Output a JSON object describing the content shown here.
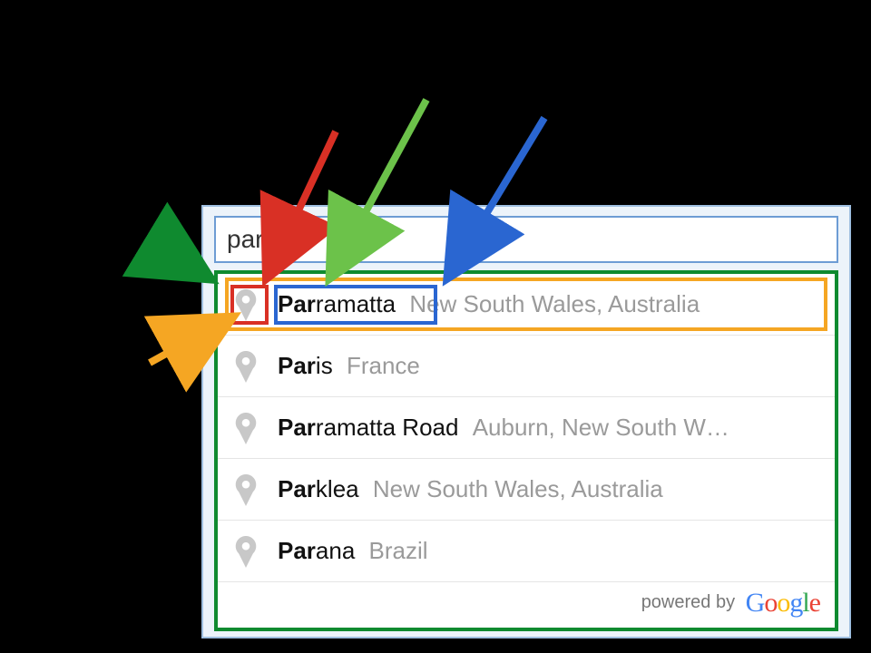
{
  "search": {
    "value": "par"
  },
  "suggestions": [
    {
      "main_bold": "Par",
      "main_rest": "ramatta",
      "secondary": "New South Wales, Australia"
    },
    {
      "main_bold": "Par",
      "main_rest": "is",
      "secondary": "France"
    },
    {
      "main_bold": "Par",
      "main_rest": "ramatta Road",
      "secondary": "Auburn, New South W…"
    },
    {
      "main_bold": "Par",
      "main_rest": "klea",
      "secondary": "New South Wales, Australia"
    },
    {
      "main_bold": "Par",
      "main_rest": "ana",
      "secondary": "Brazil"
    }
  ],
  "footer": {
    "powered_by": "powered by",
    "brand": "Google"
  },
  "annotations": {
    "green_arrow": "dropdown-container",
    "orange_arrow": "selected-item",
    "red_arrow": "marker-icon",
    "light_green_arrow": "main-text",
    "blue_arrow": "secondary-text"
  }
}
